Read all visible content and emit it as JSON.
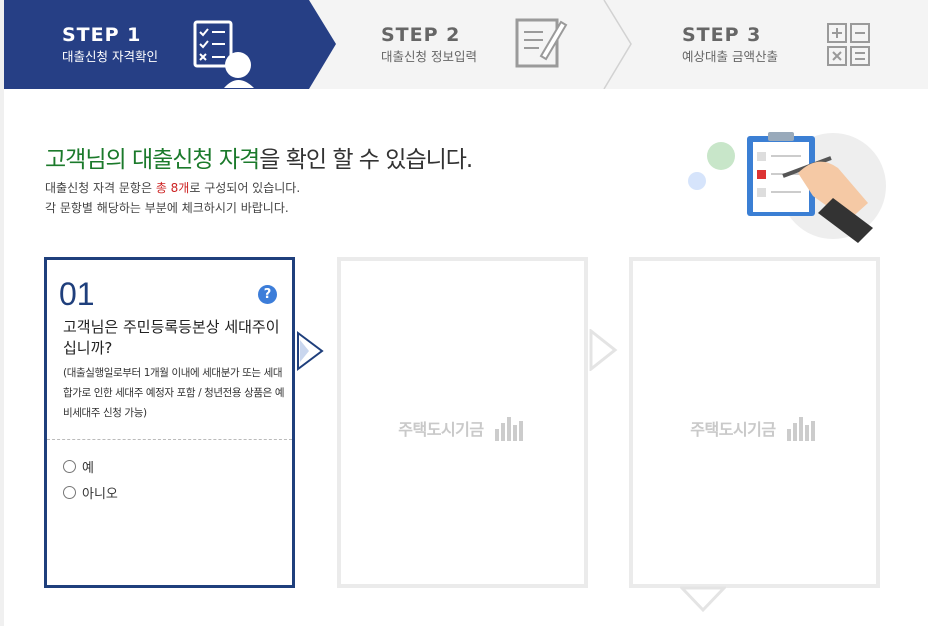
{
  "steps": [
    {
      "title": "STEP 1",
      "sub": "대출신청 자격확인"
    },
    {
      "title": "STEP 2",
      "sub": "대출신청 정보입력"
    },
    {
      "title": "STEP 3",
      "sub": "예상대출 금액산출"
    }
  ],
  "heading": {
    "part1": "고객님의 대출신청 자격",
    "part2": "을 확인 할 수 있습니다."
  },
  "description": {
    "line1_pre": "대출신청 자격 문항은 ",
    "line1_red": "총 8개",
    "line1_post": "로 구성되어 있습니다.",
    "line2": "각 문항별 해당하는 부분에 체크하시기 바랍니다."
  },
  "question": {
    "number": "01",
    "help": "?",
    "text": "고객님은 주민등록등본상 세대주이십니까?",
    "note": "(대출실행일로부터 1개월 이내에 세대분가 또는 세대합가로 인한 세대주 예정자 포함 / 청년전용 상품은 예비세대주 신청 가능)",
    "options": [
      "예",
      "아니오"
    ]
  },
  "placeholder_brand": "주택도시기금",
  "colors": {
    "active": "#1f3f7c",
    "accent_green": "#1b7a2b",
    "accent_red": "#cc2222"
  }
}
